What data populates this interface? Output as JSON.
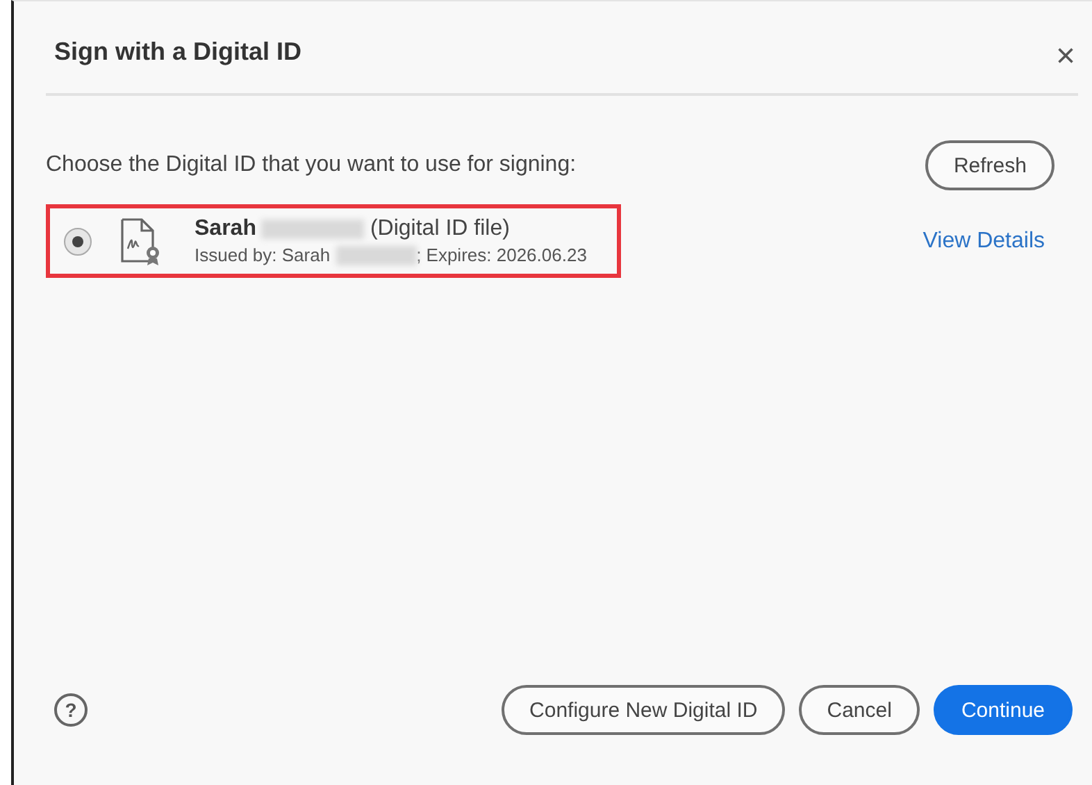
{
  "dialog": {
    "title": "Sign with a Digital ID",
    "close": "×"
  },
  "prompt": "Choose the Digital ID that you want to use for signing:",
  "refresh_button": "Refresh",
  "digital_ids": [
    {
      "name": "Sarah",
      "type": "(Digital ID file)",
      "issued_by": "Issued by: Sarah",
      "expires": "; Expires: 2026.06.23",
      "selected": true,
      "highlighted": true,
      "details_link": "View Details"
    }
  ],
  "help": "?",
  "buttons": [
    {
      "label": "Configure New Digital ID",
      "kind": "secondary"
    },
    {
      "label": "Cancel",
      "kind": "secondary"
    },
    {
      "label": "Continue",
      "kind": "primary"
    }
  ]
}
